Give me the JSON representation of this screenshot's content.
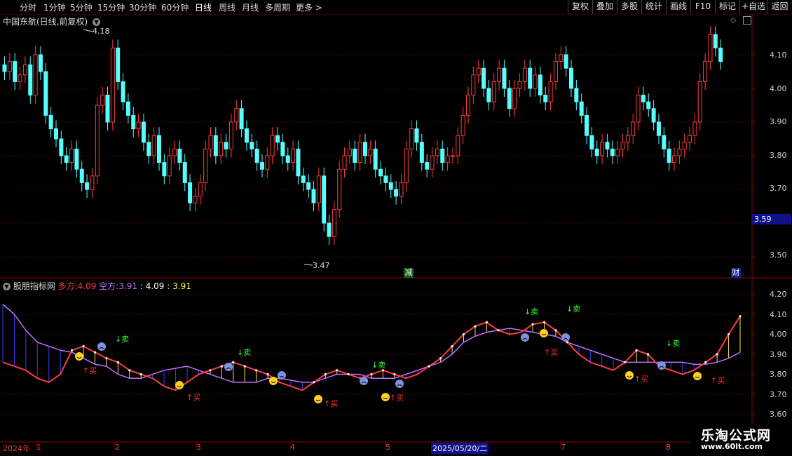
{
  "toolbar": {
    "periods": [
      "分时",
      "1分钟",
      "5分钟",
      "15分钟",
      "30分钟",
      "60分钟",
      "日线",
      "周线",
      "月线",
      "多周期",
      "更多"
    ],
    "active_period": "日线",
    "right_buttons": [
      "复权",
      "叠加",
      "多股",
      "统计",
      "画线",
      "F10",
      "标记",
      "+自选",
      "返回"
    ]
  },
  "main_chart": {
    "title": "中国东航(日线,前复权)",
    "y_ticks": [
      "4.10",
      "4.00",
      "3.90",
      "3.80",
      "3.70",
      "3.60",
      "3.50"
    ],
    "high_label": "4.18",
    "low_label": "3.47",
    "current_price_badge": "3.59",
    "marker_jian": "减",
    "marker_cai": "财"
  },
  "indicator": {
    "name": "股朋指标网",
    "duofang_label": "多方:",
    "duofang_value": "4.09",
    "kongfang_label": "空方:",
    "kongfang_value": "3.91",
    "extra_value_1": ": 4.09",
    "extra_value_2": ": 3.91",
    "y_ticks": [
      "4.20",
      "4.10",
      "4.00",
      "3.90",
      "3.80",
      "3.70",
      "3.60"
    ],
    "buy_label": "↑买",
    "sell_label": "↓卖"
  },
  "date_axis": {
    "labels": [
      "2024年",
      "1",
      "2",
      "3",
      "4",
      "5",
      "7",
      "8"
    ],
    "highlight": "2025/05/20/二"
  },
  "watermark": {
    "title": "乐淘公式网",
    "url": "www.60lt.com"
  },
  "colors": {
    "up": "#ff3c3c",
    "down": "#54ffff",
    "duofang": "#ff3c3c",
    "kongfang": "#c070ff",
    "buy": "#ff3030",
    "sell": "#30ff30"
  }
}
